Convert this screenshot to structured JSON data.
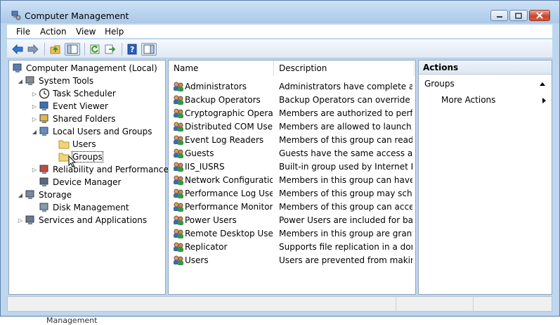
{
  "window": {
    "title": "Computer Management"
  },
  "menu": [
    "File",
    "Action",
    "View",
    "Help"
  ],
  "toolbar": {
    "buttons": [
      "back-arrow-icon",
      "forward-arrow-icon",
      "up-folder-icon",
      "show-hide-tree-icon",
      "refresh-icon",
      "export-list-icon",
      "help-icon",
      "show-hide-action-pane-icon"
    ]
  },
  "tree": [
    {
      "label": "Computer Management (Local)",
      "level": 0,
      "expander": "",
      "icon": "computer-management-icon"
    },
    {
      "label": "System Tools",
      "level": 1,
      "expander": "◢",
      "icon": "system-tools-icon"
    },
    {
      "label": "Task Scheduler",
      "level": 2,
      "expander": "▷",
      "icon": "clock-icon"
    },
    {
      "label": "Event Viewer",
      "level": 2,
      "expander": "▷",
      "icon": "event-viewer-icon"
    },
    {
      "label": "Shared Folders",
      "level": 2,
      "expander": "▷",
      "icon": "shared-folder-icon"
    },
    {
      "label": "Local Users and Groups",
      "level": 2,
      "expander": "◢",
      "icon": "users-groups-icon"
    },
    {
      "label": "Users",
      "level": 3,
      "expander": "",
      "icon": "folder-icon"
    },
    {
      "label": "Groups",
      "level": 3,
      "expander": "",
      "icon": "folder-icon"
    },
    {
      "label": "Reliability and Performance",
      "level": 2,
      "expander": "▷",
      "icon": "performance-icon"
    },
    {
      "label": "Device Manager",
      "level": 2,
      "expander": "",
      "icon": "device-manager-icon"
    },
    {
      "label": "Storage",
      "level": 1,
      "expander": "◢",
      "icon": "storage-icon"
    },
    {
      "label": "Disk Management",
      "level": 2,
      "expander": "",
      "icon": "disk-icon"
    },
    {
      "label": "Services and Applications",
      "level": 1,
      "expander": "▷",
      "icon": "services-icon"
    }
  ],
  "list": {
    "columns": [
      "Name",
      "Description"
    ],
    "rows": [
      {
        "name": "Administrators",
        "description": "Administrators have complete an..."
      },
      {
        "name": "Backup Operators",
        "description": "Backup Operators can override se..."
      },
      {
        "name": "Cryptographic Operat...",
        "description": "Members are authorized to perfor..."
      },
      {
        "name": "Distributed COM Users",
        "description": "Members are allowed to launch, a..."
      },
      {
        "name": "Event Log Readers",
        "description": "Members of this group can read e..."
      },
      {
        "name": "Guests",
        "description": "Guests have the same access as m..."
      },
      {
        "name": "IIS_IUSRS",
        "description": "Built-in group used by Internet Inf..."
      },
      {
        "name": "Network Configuratio...",
        "description": "Members in this group can have s..."
      },
      {
        "name": "Performance Log Users",
        "description": "Members of this group may sche..."
      },
      {
        "name": "Performance Monitor ...",
        "description": "Members of this group can acces..."
      },
      {
        "name": "Power Users",
        "description": "Power Users are included for back..."
      },
      {
        "name": "Remote Desktop Users",
        "description": "Members in this group are grante..."
      },
      {
        "name": "Replicator",
        "description": "Supports file replication in a dom..."
      },
      {
        "name": "Users",
        "description": "Users are prevented from making ..."
      }
    ]
  },
  "actions": {
    "title": "Actions",
    "section": "Groups",
    "more": "More Actions"
  },
  "behind_text": "Management",
  "colors": {
    "titlebar": "#b9d3ee",
    "close_button": "#c9462c",
    "pane_border": "#8fa6c1"
  }
}
